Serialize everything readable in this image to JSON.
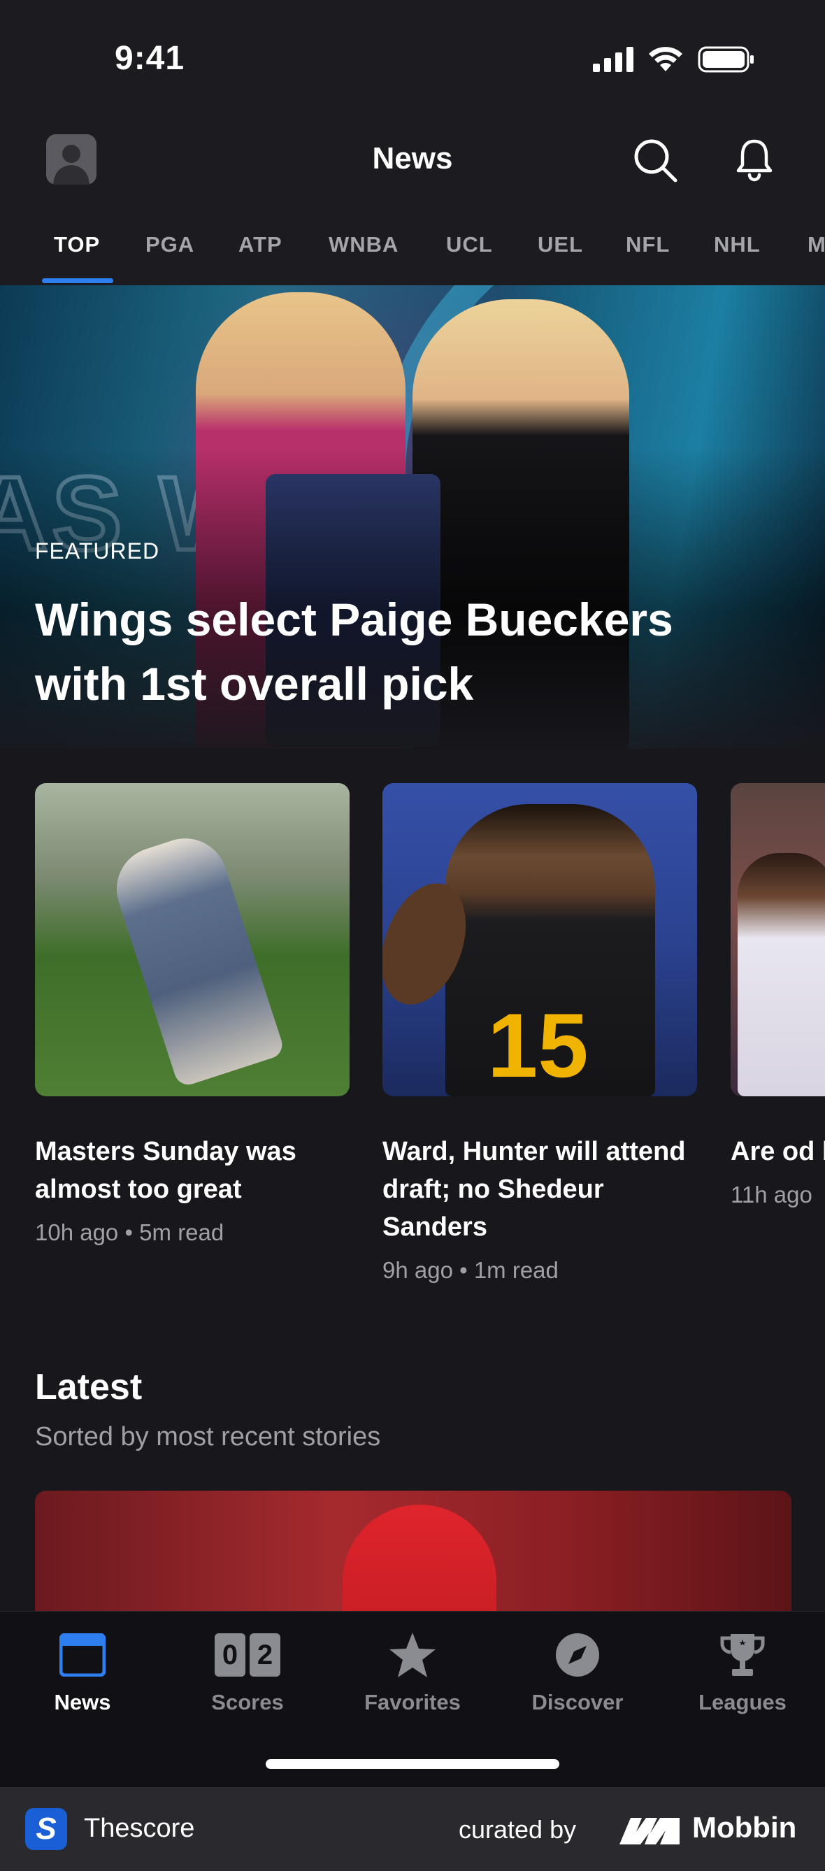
{
  "status_bar": {
    "time": "9:41"
  },
  "header": {
    "title": "News"
  },
  "tabs": [
    "TOP",
    "PGA",
    "ATP",
    "WNBA",
    "UCL",
    "UEL",
    "NFL",
    "NHL",
    "M"
  ],
  "featured": {
    "label": "FEATURED",
    "title": "Wings select Paige Bueckers with 1st overall pick"
  },
  "cards": [
    {
      "title": "Masters Sunday was almost too great",
      "meta": "10h ago • 5m read"
    },
    {
      "title": "Ward, Hunter will attend draft; no Shedeur Sanders",
      "meta": "9h ago • 1m read"
    },
    {
      "title": "Are od bettors the Kn",
      "meta": "11h ago"
    }
  ],
  "latest": {
    "title": "Latest",
    "subtitle": "Sorted by most recent stories"
  },
  "bottom_nav": {
    "items": [
      {
        "label": "News",
        "icon": "news-icon",
        "active": true
      },
      {
        "label": "Scores",
        "icon": "scores-icon",
        "active": false
      },
      {
        "label": "Favorites",
        "icon": "star-icon",
        "active": false
      },
      {
        "label": "Discover",
        "icon": "compass-icon",
        "active": false
      },
      {
        "label": "Leagues",
        "icon": "trophy-icon",
        "active": false
      }
    ],
    "scores_digits": [
      "0",
      "2"
    ]
  },
  "footer": {
    "app_name": "Thescore",
    "curated_by": "curated by",
    "brand": "Mobbin",
    "logo_letter": "S"
  },
  "colors": {
    "accent": "#2d7ff0",
    "background": "#18171c",
    "inactive": "#8b8b92"
  }
}
